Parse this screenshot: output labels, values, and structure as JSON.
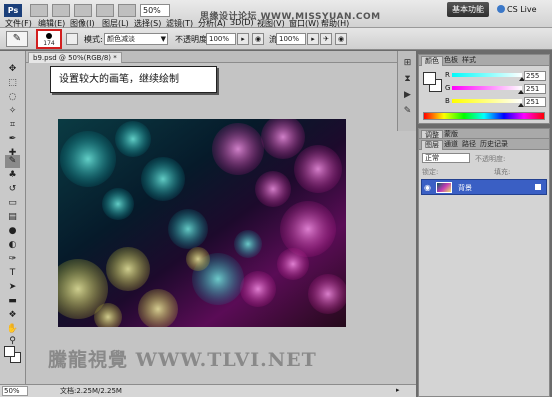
{
  "menubar": {
    "logo": "Ps",
    "zoom": "50%",
    "items": [
      "文件(F)",
      "编辑(E)",
      "图像(I)",
      "图层(L)",
      "选择(S)",
      "滤镜(T)",
      "分析(A)",
      "3D(D)",
      "视图(V)",
      "窗口(W)",
      "帮助(H)"
    ],
    "workspace": "基本功能",
    "cslive": "CS Live",
    "watermark": "思缘设计论坛  WWW.MISSYUAN.COM"
  },
  "options": {
    "brush_size": "174",
    "mode_label": "模式:",
    "mode_value": "颜色减淡",
    "opacity_label": "不透明度:",
    "opacity_value": "100%",
    "flow_label": "流量:",
    "flow_value": "100%"
  },
  "document": {
    "tab_label": "b9.psd @ 50%(RGB/8) *",
    "callout": "设置较大的画笔，继续绘制",
    "watermark": "騰龍視覺 WWW.TLVI.NET"
  },
  "status": {
    "zoom": "50%",
    "doc_info": "文档:2.25M/2.25M"
  },
  "color_panel": {
    "tabs": [
      "颜色",
      "色板",
      "样式"
    ],
    "channels": [
      {
        "label": "R",
        "value": "255",
        "level": 1.0,
        "gradient": "linear-gradient(to right, #00fbfb, #fff)"
      },
      {
        "label": "G",
        "value": "251",
        "level": 0.984,
        "gradient": "linear-gradient(to right, #ff00fb, #fff)"
      },
      {
        "label": "B",
        "value": "251",
        "level": 0.984,
        "gradient": "linear-gradient(to right, #ffff00, #fff)"
      }
    ]
  },
  "adjust_panel": {
    "tabs": [
      "调整",
      "蒙版"
    ]
  },
  "layers_panel": {
    "tabs": [
      "图层",
      "通道",
      "路径",
      "历史记录"
    ],
    "blend_mode": "正常",
    "opacity_label": "不透明度:",
    "lock_label": "锁定:",
    "fill_label": "填充:",
    "layer_name": "背景"
  },
  "colors": {
    "accent_red": "#d21f1f",
    "layer_selected": "#3a5fc4"
  }
}
